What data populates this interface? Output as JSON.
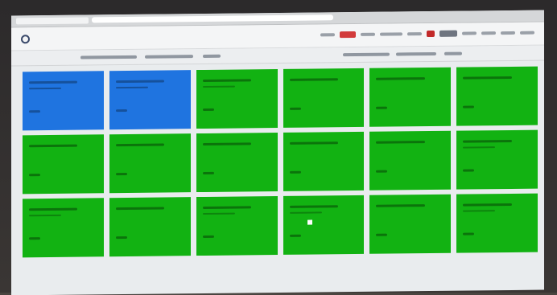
{
  "colors": {
    "tile_green": "#12b212",
    "tile_blue": "#1f74e0",
    "page_bg": "#e9ecee"
  },
  "header": {
    "logo_icon": "logo-icon"
  },
  "grid": {
    "tiles": [
      {
        "status": "blue"
      },
      {
        "status": "blue"
      },
      {
        "status": "green"
      },
      {
        "status": "green"
      },
      {
        "status": "green"
      },
      {
        "status": "green"
      },
      {
        "status": "green"
      },
      {
        "status": "green"
      },
      {
        "status": "green"
      },
      {
        "status": "green"
      },
      {
        "status": "green"
      },
      {
        "status": "green"
      },
      {
        "status": "green"
      },
      {
        "status": "green"
      },
      {
        "status": "green"
      },
      {
        "status": "green"
      },
      {
        "status": "green"
      },
      {
        "status": "green"
      }
    ]
  }
}
